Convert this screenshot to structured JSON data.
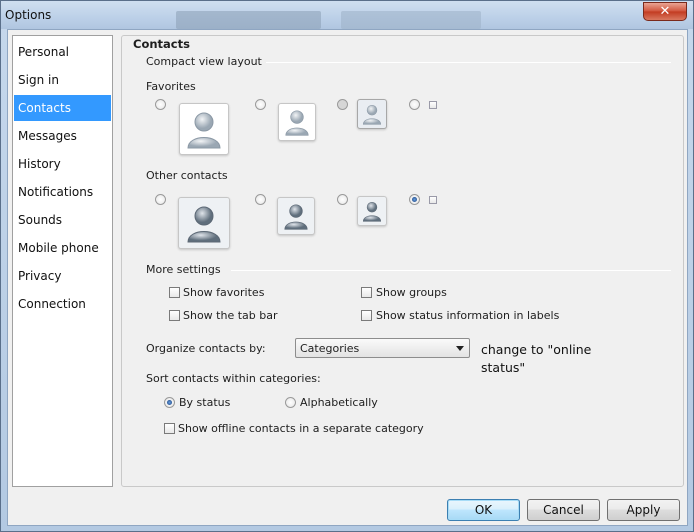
{
  "window": {
    "title": "Options",
    "close_label": "✕"
  },
  "nav": {
    "items": [
      {
        "label": "Personal"
      },
      {
        "label": "Sign in"
      },
      {
        "label": "Contacts",
        "selected": true
      },
      {
        "label": "Messages"
      },
      {
        "label": "History"
      },
      {
        "label": "Notifications"
      },
      {
        "label": "Sounds"
      },
      {
        "label": "Mobile phone"
      },
      {
        "label": "Privacy"
      },
      {
        "label": "Connection"
      }
    ]
  },
  "panel": {
    "title": "Contacts",
    "compact_view_layout": "Compact view layout",
    "favorites_label": "Favorites",
    "favorites_selected_index": 2,
    "other_contacts_label": "Other contacts",
    "other_selected_index": 3,
    "more_settings": "More settings",
    "checkboxes": {
      "show_favorites": {
        "label": "Show favorites",
        "checked": false
      },
      "show_groups": {
        "label": "Show groups",
        "checked": false
      },
      "show_tab_bar": {
        "label": "Show the tab bar",
        "checked": false
      },
      "show_status_info": {
        "label": "Show status information in labels",
        "checked": false
      }
    },
    "organize_label": "Organize contacts by:",
    "organize_value": "Categories",
    "sort_label": "Sort contacts within categories:",
    "sort_by_status": {
      "label": "By status",
      "checked": true
    },
    "sort_alphabetically": {
      "label": "Alphabetically",
      "checked": false
    },
    "show_offline": {
      "label": "Show offline contacts in a separate category",
      "checked": false
    }
  },
  "annotation": "change to \"online status\"",
  "buttons": {
    "ok": "OK",
    "cancel": "Cancel",
    "apply": "Apply"
  },
  "colors": {
    "selection": "#3399ff",
    "radio_dot": "#1c4a8c"
  }
}
